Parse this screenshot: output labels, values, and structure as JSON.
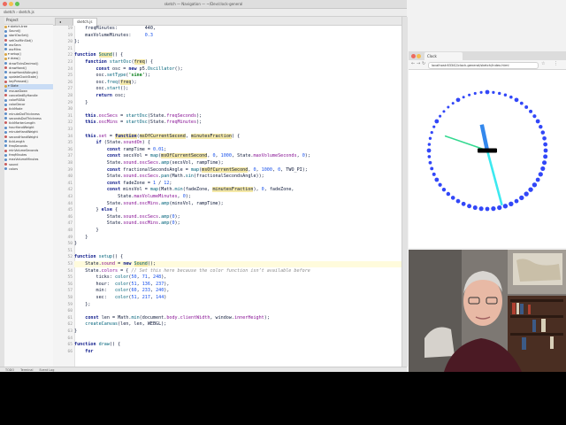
{
  "ide": {
    "window_title": "sketch — Navigation — ~/Dev/clock-general",
    "nav_path": "sketch  ›  sketch.js",
    "project_header": "Project",
    "tree": [
      "▾ sketch-tree",
      "  Sound()",
      "  startOscSet()",
      "  setOscMinSlot()",
      "  oscSecs",
      "  oscMins",
      "▾ setup()",
      "▾ draw()",
      "  drawTicksDecimal()",
      "  drawHand()",
      "  drawHandAtAngle()",
      "  updateClockState()",
      "  keyPressed()",
      "▾ State",
      "  mouseDown",
      "  cancelledByHandle",
      "  colorRGBA",
      "  colorDecor",
      "  tickMode",
      "  minuteDotThickness",
      "  secondsDotThickness",
      "  tickMarkerLength",
      "  hourHandWeight",
      "  minuteHandWeight",
      "  secondHandWeight",
      "  tickLength",
      "  freqSeconds",
      "  minVolumeSeconds",
      "  freqMinutes",
      "  maxVolumeMinutes",
      "  sound",
      "  colors"
    ],
    "tabs": [
      "sketch.js"
    ],
    "status_items": [
      "TODO",
      "Terminal",
      "Event Log"
    ],
    "lines": [
      {
        "n": "19",
        "html": "    freqMinutes:          440,"
      },
      {
        "n": "19",
        "html": "    maxVolumeMinutes:     <span class='num'>0.3</span>"
      },
      {
        "n": "20",
        "html": "};"
      },
      {
        "n": "21",
        "html": ""
      },
      {
        "n": "22",
        "html": "<span class='kw'>function</span> <span class='tok-hl'><span class='fn'>Sound</span></span>() {"
      },
      {
        "n": "23",
        "html": "    <span class='kw'>function</span> <span class='fn'>startOsc</span>(<span class='tok-hl'>freq</span>) {"
      },
      {
        "n": "24",
        "html": "        <span class='kw'>const</span> osc = <span class='kw'>new</span> p5.<span class='fn'>Oscillator</span>();"
      },
      {
        "n": "25",
        "html": "        osc.<span class='fn'>setType</span>(<span class='str'>'sine'</span>);"
      },
      {
        "n": "26",
        "html": "        osc.<span class='fn'>freq</span>(<span class='tok-hl'>freq</span>);"
      },
      {
        "n": "27",
        "html": "        osc.<span class='fn'>start</span>();"
      },
      {
        "n": "28",
        "html": "        <span class='kw'>return</span> osc;"
      },
      {
        "n": "29",
        "html": "    }"
      },
      {
        "n": "30",
        "html": ""
      },
      {
        "n": "31",
        "html": "    <span class='kw'>this</span>.<span class='prop'>oscSecs</span> = <span class='fn'>startOsc</span>(State.<span class='prop'>freqSeconds</span>);"
      },
      {
        "n": "32",
        "html": "    <span class='kw'>this</span>.<span class='prop'>oscMins</span> = <span class='fn'>startOsc</span>(State.<span class='prop'>freqMinutes</span>);"
      },
      {
        "n": "33",
        "html": ""
      },
      {
        "n": "34",
        "html": "    <span class='kw'>this</span>.<span class='prop'>set</span> = <span class='tok-hl'><span class='kw'>function</span></span>(<span class='tok-hl'>msOfCurrentSecond</span>, <span class='tok-hl'>minutesFraction</span>) {"
      },
      {
        "n": "35",
        "html": "        <span class='kw'>if</span> (State.<span class='prop'>soundOn</span>) {"
      },
      {
        "n": "36",
        "html": "            <span class='kw'>const</span> rampTime = <span class='num'>0.01</span>;"
      },
      {
        "n": "37",
        "html": "            <span class='kw'>const</span> secsVol = <span class='fn'>map</span>(<span class='tok-hl'>msOfCurrentSecond</span>, <span class='num'>0</span>, <span class='num'>1000</span>, State.<span class='prop'>maxVolumeSeconds</span>, <span class='num'>0</span>);"
      },
      {
        "n": "38",
        "html": "            State.<span class='prop'>sound</span>.<span class='prop'>oscSecs</span>.<span class='fn'>amp</span>(secsVol, rampTime);"
      },
      {
        "n": "39",
        "html": "            <span class='kw'>const</span> fractionalSecondsAngle = <span class='fn'>map</span>(<span class='tok-hl'>msOfCurrentSecond</span>, <span class='num'>0</span>, <span class='num'>1000</span>, <span class='num'>0</span>, TWO_PI);"
      },
      {
        "n": "40",
        "html": "            State.<span class='prop'>sound</span>.<span class='prop'>oscSecs</span>.<span class='fn'>pan</span>(Math.<span class='fn'>sin</span>(fractionalSecondsAngle));"
      },
      {
        "n": "41",
        "html": "            <span class='kw'>const</span> fadeZone = <span class='num'>1</span> / <span class='num'>12</span>;"
      },
      {
        "n": "42",
        "html": "            <span class='kw'>const</span> minsVol = <span class='fn'>map</span>(Math.<span class='fn'>min</span>(fadeZone, <span class='tok-hl'>minutesFraction</span>), <span class='num'>0</span>, fadeZone,"
      },
      {
        "n": "43",
        "html": "                State.<span class='prop'>maxVolumeMinutes</span>, <span class='num'>0</span>);"
      },
      {
        "n": "44",
        "html": "            State.<span class='prop'>sound</span>.<span class='prop'>oscMins</span>.<span class='fn'>amp</span>(minsVol, rampTime);"
      },
      {
        "n": "45",
        "html": "        } <span class='kw'>else</span> {"
      },
      {
        "n": "46",
        "html": "            State.<span class='prop'>sound</span>.<span class='prop'>oscSecs</span>.<span class='fn'>amp</span>(<span class='num'>0</span>);"
      },
      {
        "n": "47",
        "html": "            State.<span class='prop'>sound</span>.<span class='prop'>oscMins</span>.<span class='fn'>amp</span>(<span class='num'>0</span>);"
      },
      {
        "n": "48",
        "html": "        }"
      },
      {
        "n": "49",
        "html": "    }"
      },
      {
        "n": "50",
        "html": "}"
      },
      {
        "n": "51",
        "html": ""
      },
      {
        "n": "52",
        "html": "<span class='kw'>function</span> <span class='fn'>setup</span>() {"
      },
      {
        "n": "53",
        "html": "    State.<span class='prop'>sound</span> = <span class='kw'>new</span> <span class='tok-hl'><span class='fn'>Sound</span></span>();",
        "hl": true
      },
      {
        "n": "54",
        "html": "    State.<span class='prop'>colors</span> = { <span class='com'>// Set this here because the color function isn’t available before</span>"
      },
      {
        "n": "55",
        "html": "        ticks: <span class='fn'>color</span>(<span class='num'>50</span>, <span class='num'>71</span>, <span class='num'>248</span>),"
      },
      {
        "n": "56",
        "html": "        hour:  <span class='fn'>color</span>(<span class='num'>51</span>, <span class='num'>136</span>, <span class='num'>237</span>),"
      },
      {
        "n": "57",
        "html": "        min:   <span class='fn'>color</span>(<span class='num'>60</span>, <span class='num'>233</span>, <span class='num'>240</span>),"
      },
      {
        "n": "58",
        "html": "        sec:   <span class='fn'>color</span>(<span class='num'>51</span>, <span class='num'>217</span>, <span class='num'>144</span>)"
      },
      {
        "n": "59",
        "html": "    };"
      },
      {
        "n": "60",
        "html": ""
      },
      {
        "n": "61",
        "html": "    <span class='kw'>const</span> len = Math.<span class='fn'>min</span>(document.<span class='prop'>body</span>.<span class='prop'>clientWidth</span>, window.<span class='prop'>innerHeight</span>);"
      },
      {
        "n": "62",
        "html": "    <span class='fn'>createCanvas</span>(len, len, WEBGL);"
      },
      {
        "n": "63",
        "html": "}"
      },
      {
        "n": "64",
        "html": ""
      },
      {
        "n": "65",
        "html": "<span class='kw'>function</span> <span class='fn'>draw</span>() {"
      },
      {
        "n": "66",
        "html": "    <span class='kw'>for</span>"
      }
    ]
  },
  "browser": {
    "tab_title": "Clock",
    "url": "localhost:63342/clock-general/sketch/index.html",
    "clock": {
      "tick_color": "#3247f8",
      "hour_color": "#3388ed",
      "minute_color": "#3ce9f0",
      "second_color": "#33d990",
      "hub_color": "#000000",
      "hour_angle_deg": -12,
      "minute_angle_deg": 165,
      "second_angle_deg": -71
    }
  },
  "colors": {
    "ide_bg": "#ffffff",
    "gutter": "#f4f4f4",
    "highlight_line": "#fffbdc"
  }
}
